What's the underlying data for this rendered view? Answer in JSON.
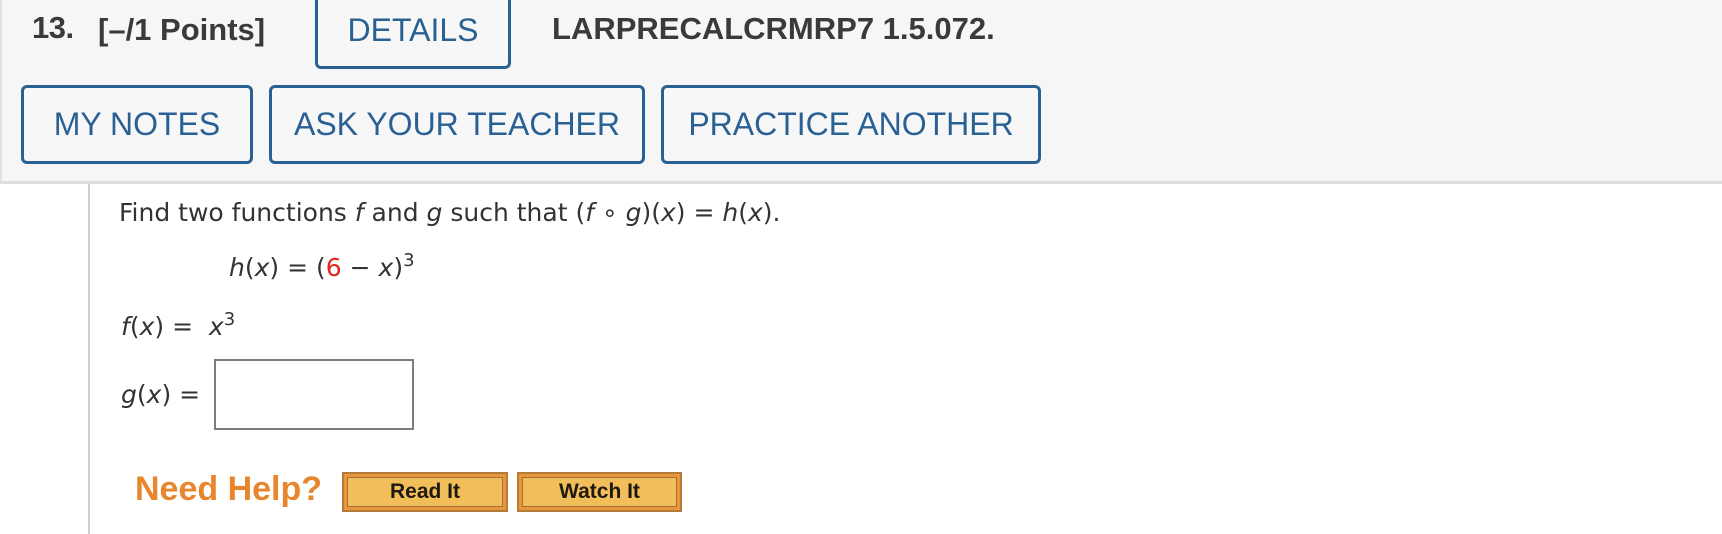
{
  "header": {
    "question_number": "13.",
    "points": "[–/1 Points]",
    "details_label": "DETAILS",
    "assignment_code": "LARPRECALCRMRP7 1.5.072.",
    "buttons": {
      "my_notes": "MY NOTES",
      "ask_teacher": "ASK YOUR TEACHER",
      "practice_another": "PRACTICE ANOTHER"
    }
  },
  "question": {
    "prompt_part1": "Find two functions ",
    "f": "f",
    "prompt_and": " and ",
    "g": "g",
    "prompt_part2": " such that (",
    "compose_f": "f",
    "compose_op": " ∘ ",
    "compose_g": "g",
    "compose_tail": ")(",
    "compose_x": "x",
    "compose_eq": ") = ",
    "h": "h",
    "h_open": "(",
    "h_x": "x",
    "h_close": ").",
    "given": {
      "lhs_h": "h",
      "lhs_open": "(",
      "lhs_x": "x",
      "lhs_close": ") = (",
      "constant": "6",
      "minus": " − ",
      "var": "x",
      "rparen": ")",
      "exponent": "3"
    },
    "f_given": {
      "label_f": "f",
      "label_open": "(",
      "label_x": "x",
      "label_close": ") =  ",
      "value_var": "x",
      "value_exp": "3"
    },
    "g_answer": {
      "label_g": "g",
      "label_open": "(",
      "label_x": "x",
      "label_close": ") =",
      "value": ""
    },
    "accent_color": "#e0281c"
  },
  "help": {
    "label": "Need Help?",
    "read_it": "Read It",
    "watch_it": "Watch It"
  }
}
